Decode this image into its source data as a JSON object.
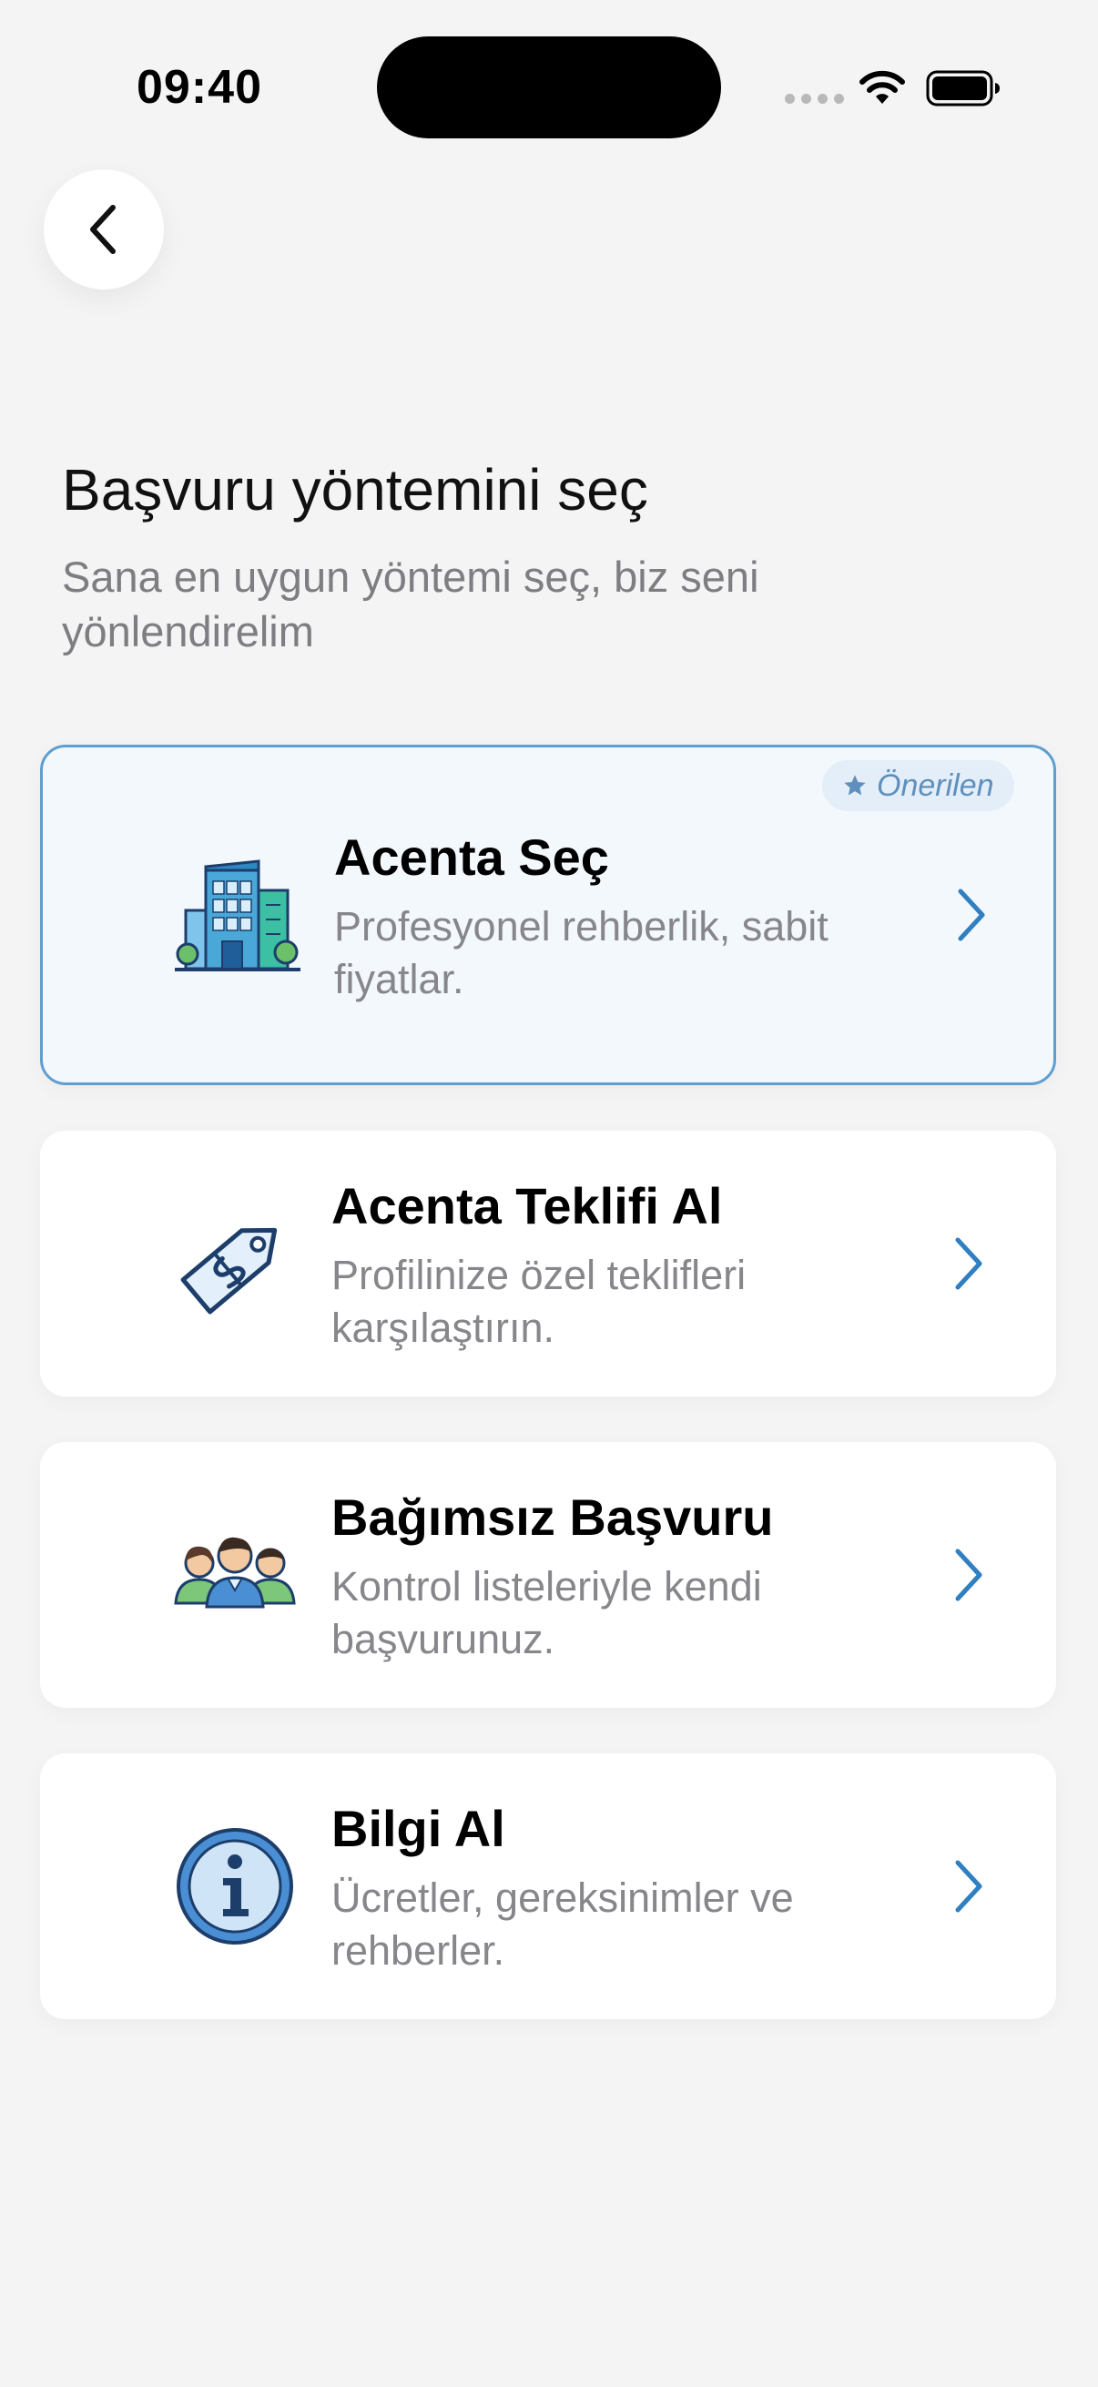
{
  "status_bar": {
    "time": "09:40"
  },
  "header": {
    "title": "Başvuru yöntemini seç",
    "subtitle": "Sana en uygun yöntemi seç, biz seni yönlendirelim"
  },
  "options": [
    {
      "title": "Acenta Seç",
      "description": "Profesyonel rehberlik, sabit fiyatlar.",
      "badge": "Önerilen",
      "icon": "office-building-icon"
    },
    {
      "title": "Acenta Teklifi Al",
      "description": "Profilinize özel teklifleri karşılaştırın.",
      "icon": "price-tag-icon"
    },
    {
      "title": "Bağımsız Başvuru",
      "description": "Kontrol listeleriyle kendi başvurunuz.",
      "icon": "group-people-icon"
    },
    {
      "title": "Bilgi Al",
      "description": "Ücretler, gereksinimler ve rehberler.",
      "icon": "info-icon"
    }
  ],
  "colors": {
    "accent": "#2f7fc1",
    "recommended_border": "#5f9ecf",
    "recommended_bg": "#f3f8fd",
    "background": "#f4f4f5"
  }
}
